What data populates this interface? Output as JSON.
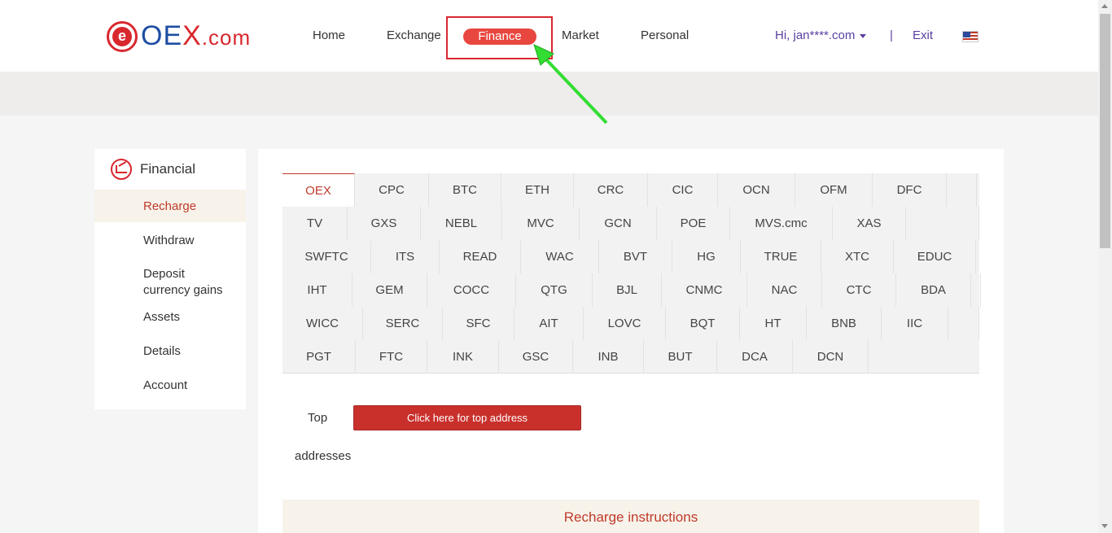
{
  "header": {
    "logo_e": "e",
    "logo_text_o": "OE",
    "logo_text_x": "X",
    "logo_text_dom": ".com",
    "nav": {
      "home": "Home",
      "exchange": "Exchange",
      "finance": "Finance",
      "market": "Market",
      "personal": "Personal"
    },
    "user": "Hi, jan****.com",
    "separator": "|",
    "exit": "Exit",
    "flag_icon": "us-flag-icon"
  },
  "sidebar": {
    "title": "Financial",
    "items": [
      {
        "label": "Recharge",
        "active": true
      },
      {
        "label": "Withdraw",
        "active": false
      },
      {
        "label": "Deposit currency gains",
        "active": false
      },
      {
        "label": "Assets",
        "active": false
      },
      {
        "label": "Details",
        "active": false
      },
      {
        "label": "Account",
        "active": false
      }
    ]
  },
  "coins": [
    [
      "OEX",
      "CPC",
      "BTC",
      "ETH",
      "CRC",
      "CIC",
      "OCN",
      "OFM",
      "DFC"
    ],
    [
      "TV",
      "GXS",
      "NEBL",
      "MVC",
      "GCN",
      "POE",
      "MVS.cmc",
      "XAS"
    ],
    [
      "SWFTC",
      "ITS",
      "READ",
      "WAC",
      "BVT",
      "HG",
      "TRUE",
      "XTC",
      "EDUC"
    ],
    [
      "IHT",
      "GEM",
      "COCC",
      "QTG",
      "BJL",
      "CNMC",
      "NAC",
      "CTC",
      "BDA"
    ],
    [
      "WICC",
      "SERC",
      "SFC",
      "AIT",
      "LOVC",
      "BQT",
      "HT",
      "BNB",
      "IIC"
    ],
    [
      "PGT",
      "FTC",
      "INK",
      "GSC",
      "INB",
      "BUT",
      "DCA",
      "DCN"
    ]
  ],
  "active_coin": "OEX",
  "top_section": {
    "label": "Top",
    "button": "Click here for top address",
    "addresses_label": "addresses"
  },
  "instructions": "Recharge instructions",
  "colors": {
    "accent": "#c0392b",
    "nav_active": "#e8473f",
    "user_link": "#5a3fa0",
    "annotation_arrow": "#33dd33"
  }
}
